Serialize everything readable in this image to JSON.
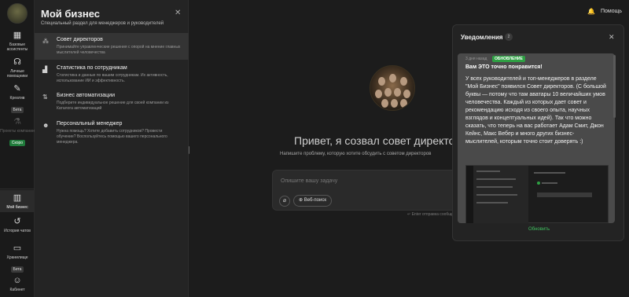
{
  "rail": {
    "items": [
      {
        "label": "Базовые ассистенты",
        "icon": "grid-icon"
      },
      {
        "label": "Личные помощники",
        "icon": "headset-icon"
      },
      {
        "label": "Креатив",
        "icon": "palette-icon",
        "badge": "Бета"
      },
      {
        "label": "Проекты компании",
        "icon": "flask-icon",
        "badge": "Скоро"
      },
      {
        "label": "Мой бизнес",
        "icon": "building-icon"
      },
      {
        "label": "История чатов",
        "icon": "history-icon"
      },
      {
        "label": "Хранилище",
        "icon": "folder-icon",
        "badge": "Бета"
      },
      {
        "label": "Кабинет",
        "icon": "user-icon"
      }
    ]
  },
  "panel": {
    "title": "Мой бизнес",
    "subtitle": "Специальный раздел для менеджеров и руководителей",
    "items": [
      {
        "title": "Совет директоров",
        "desc": "Принимайте управленческие решения с опорой на мнение главных мыслителей человечества"
      },
      {
        "title": "Статистика по сотрудникам",
        "desc": "Статистика и данные по вашим сотрудникам. Их активность, использование ИИ и эффективность."
      },
      {
        "title": "Бизнес автоматизации",
        "desc": "Подберите индивидуальное решение для своей компании из Каталога автоматизаций"
      },
      {
        "title": "Персональный менеджер",
        "desc": "Нужна помощь? Хотите добавить сотрудников? Провести обучение? Воспользуйтесь помощью вашего персонального менеджера."
      }
    ]
  },
  "header": {
    "help": "Помощь"
  },
  "main": {
    "greeting": "Привет, я созвал совет директоров",
    "greeting_sub": "Напишите проблему, которую хотите обсудить с советом директоров",
    "input_placeholder": "Опишите вашу задачу",
    "web_search": "Веб-поиск",
    "enter_hint": "↵ Enter отправка сообщения"
  },
  "notifications": {
    "title": "Уведомления",
    "count": "2",
    "card": {
      "meta": "3 дня назад",
      "badge": "ОБНОВЛЕНИЕ",
      "heading": "Вам ЭТО точно понравится!",
      "body": "У всех руководителей и топ-менеджеров в разделе \"Мой Бизнес\" появился Совет директоров. (С большой буквы — потому что там аватары 10 величайших умов человечества. Каждый из которых дает совет и рекомендацию исходя из своего опыта, научных взглядов и концептуальных идей). Так что можно сказать, что теперь на вас работает Адам Смит, Джон Кейнс, Макс Вебер и много других бизнес-мыслителей, которым точно стоит доверять :)"
    },
    "refresh": "Обновить"
  },
  "colors": {
    "accent": "#2ea043",
    "background": "#1c1c1c",
    "panel": "#242424"
  }
}
